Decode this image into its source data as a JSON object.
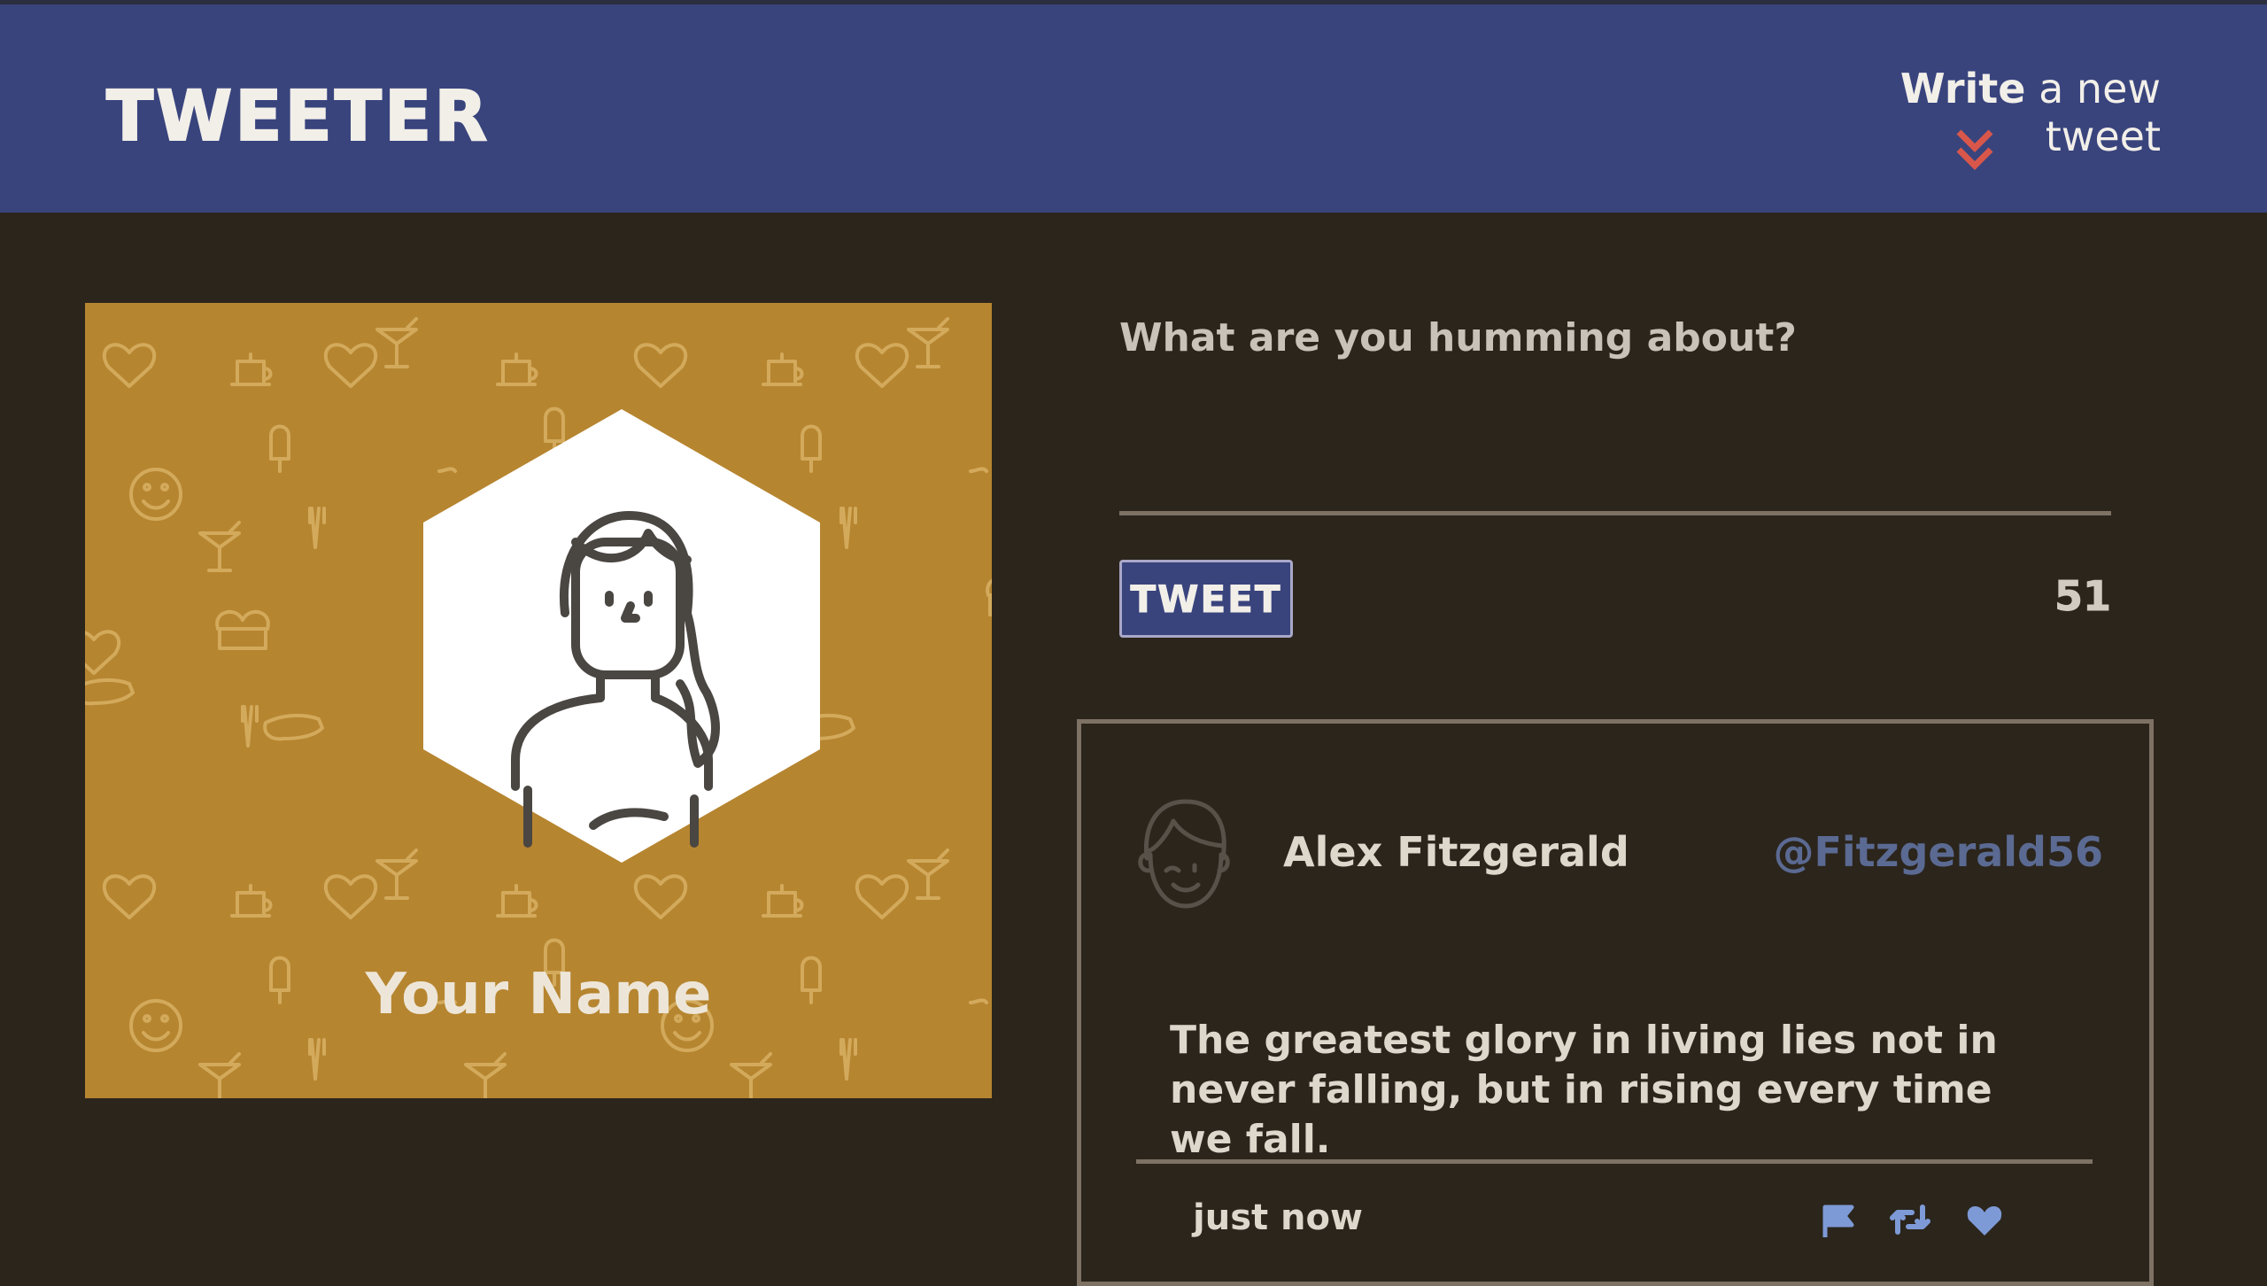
{
  "nav": {
    "brand": "TWEETER",
    "compose_bold": "Write",
    "compose_rest": " a new tweet",
    "chevron_icon": "double-chevron-down-icon",
    "chevron_color": "#d9574a"
  },
  "profile": {
    "name": "Your Name",
    "background_color": "#b68530",
    "avatar_icon": "woman-avatar-icon"
  },
  "composer": {
    "placeholder": "What are you humming about?",
    "value": "",
    "submit_label": "TWEET",
    "counter": "51"
  },
  "tweet": {
    "author": "Alex Fitzgerald",
    "handle": "@Fitzgerald56",
    "body": "The greatest glory in living lies not in never falling, but in rising every time we fall.",
    "time": "just now",
    "actions": [
      "flag-icon",
      "retweet-icon",
      "heart-icon"
    ],
    "action_color": "#7e9ad6"
  },
  "colors": {
    "nav": "#39447d",
    "page": "#2b251c",
    "border": "#7e7264"
  }
}
